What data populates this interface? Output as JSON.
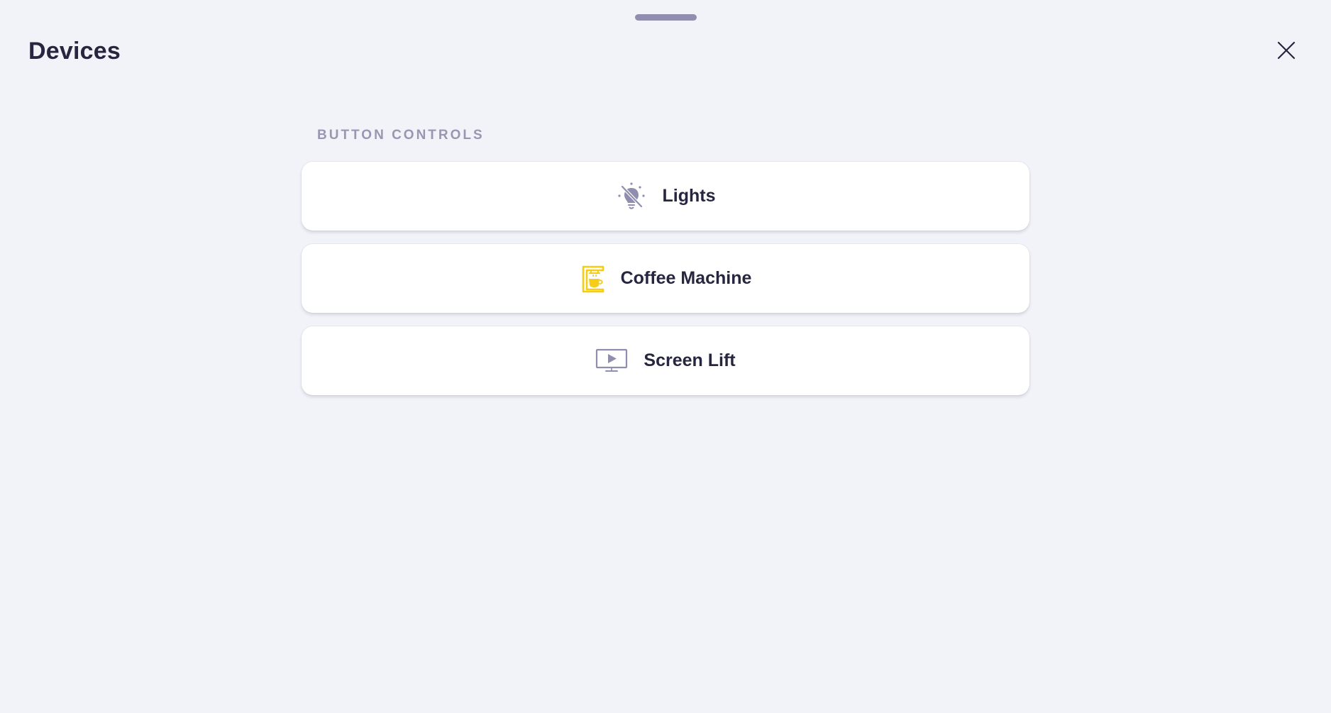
{
  "page": {
    "title": "Devices"
  },
  "header": {
    "close_icon": "close-icon",
    "drag_handle_icon": "drag-handle"
  },
  "section": {
    "label": "BUTTON CONTROLS"
  },
  "controls": [
    {
      "label": "Lights",
      "icon": "light-off-icon",
      "icon_color": "#8f8eae"
    },
    {
      "label": "Coffee Machine",
      "icon": "coffee-machine-icon",
      "icon_color": "#f5cc16"
    },
    {
      "label": "Screen Lift",
      "icon": "screen-lift-icon",
      "icon_color": "#8f8eae"
    }
  ],
  "colors": {
    "background": "#f2f3f8",
    "card": "#ffffff",
    "text": "#262640",
    "muted": "#9897b2",
    "accent_yellow": "#f5cc16"
  }
}
